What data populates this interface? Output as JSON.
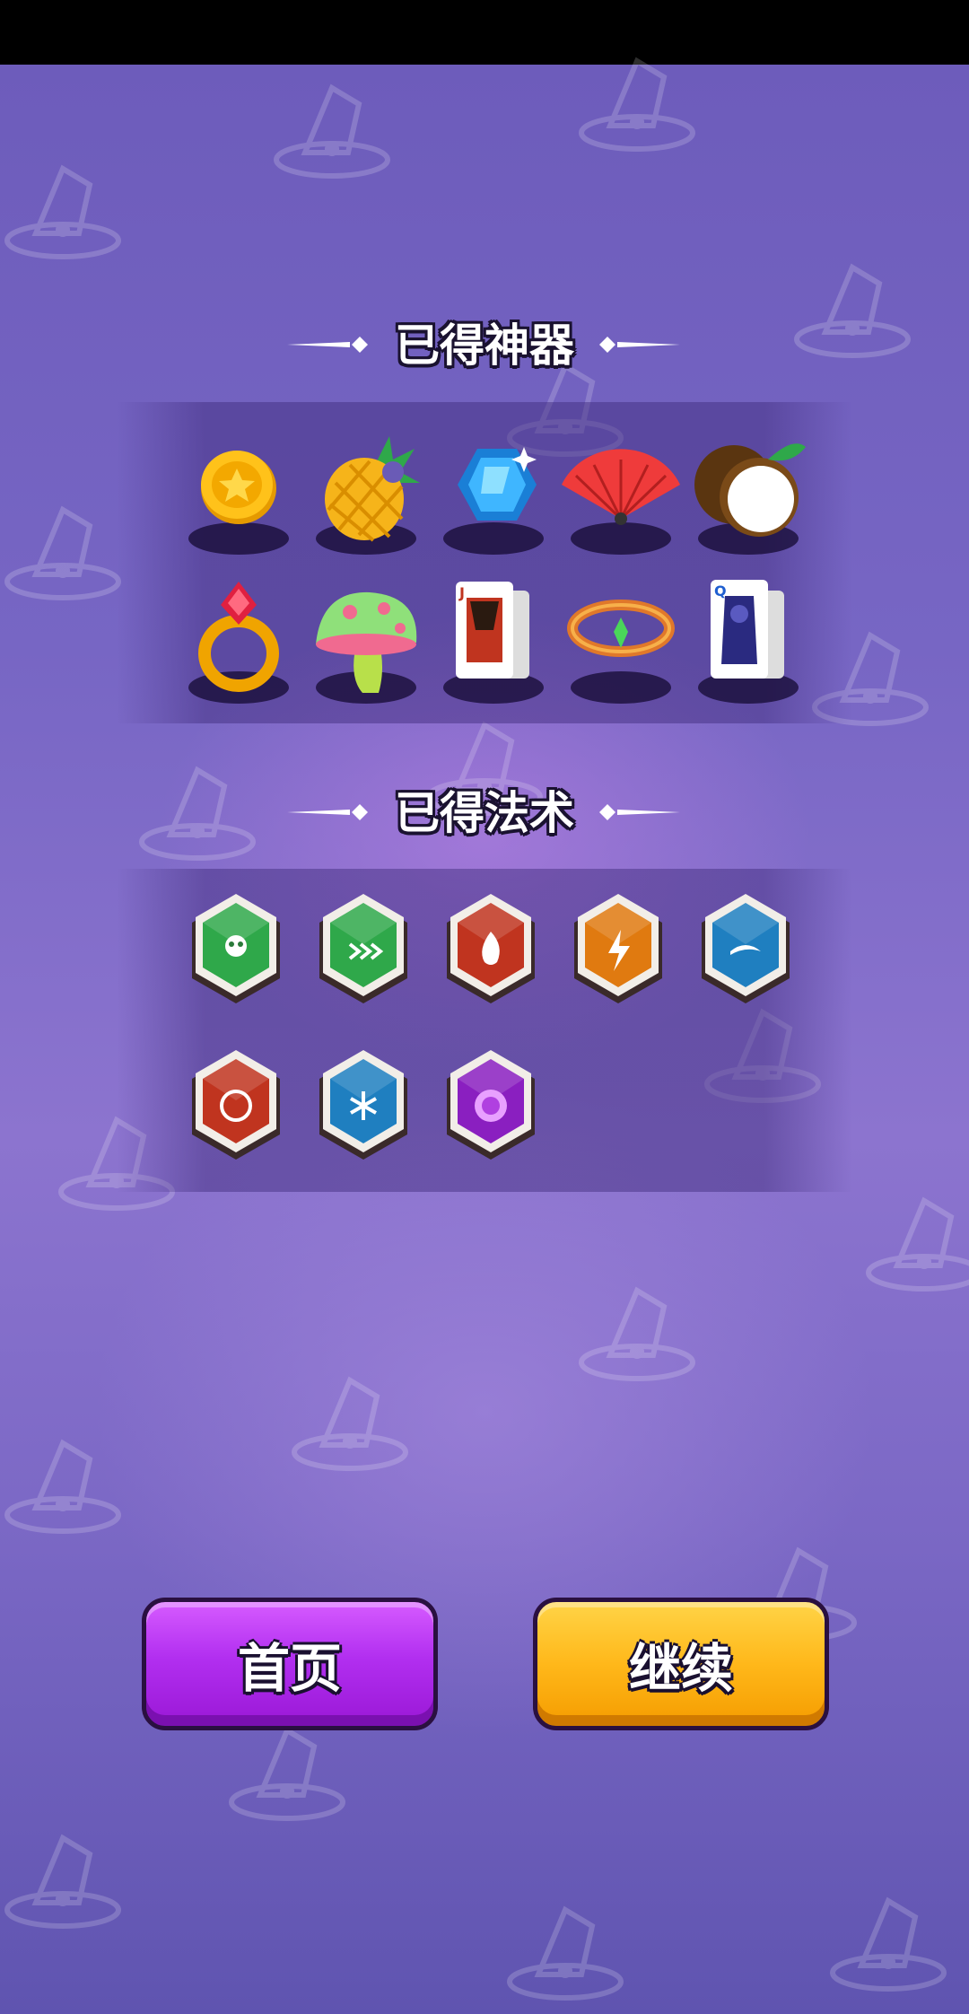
{
  "artifacts_section": {
    "title": "已得神器",
    "items": [
      {
        "icon": "gold-coin-icon"
      },
      {
        "icon": "pineapple-icon"
      },
      {
        "icon": "blue-gem-icon"
      },
      {
        "icon": "red-fan-icon"
      },
      {
        "icon": "coconut-icon"
      },
      {
        "icon": "ruby-ring-icon"
      },
      {
        "icon": "mushroom-icon"
      },
      {
        "icon": "jack-card-icon"
      },
      {
        "icon": "gem-bracelet-icon"
      },
      {
        "icon": "queen-card-icon"
      }
    ]
  },
  "spells_section": {
    "title": "已得法术",
    "items": [
      {
        "icon": "poison-skull-shield-icon",
        "color": "#2fa84a"
      },
      {
        "icon": "speed-arrows-shield-icon",
        "color": "#2fa84a"
      },
      {
        "icon": "fire-burst-shield-icon",
        "color": "#c0341f"
      },
      {
        "icon": "lightning-shield-icon",
        "color": "#e07a10"
      },
      {
        "icon": "water-shield-icon",
        "color": "#1f7fc0"
      },
      {
        "icon": "fire-ring-shield-icon",
        "color": "#c0341f"
      },
      {
        "icon": "frost-shield-icon",
        "color": "#1f7fc0"
      },
      {
        "icon": "purple-orb-icon",
        "color": "#8a1fc0"
      }
    ]
  },
  "buttons": {
    "home_label": "首页",
    "continue_label": "继续"
  },
  "colors": {
    "background": "#7766c4",
    "home_button": "#b22ff0",
    "continue_button": "#ffb81a"
  }
}
